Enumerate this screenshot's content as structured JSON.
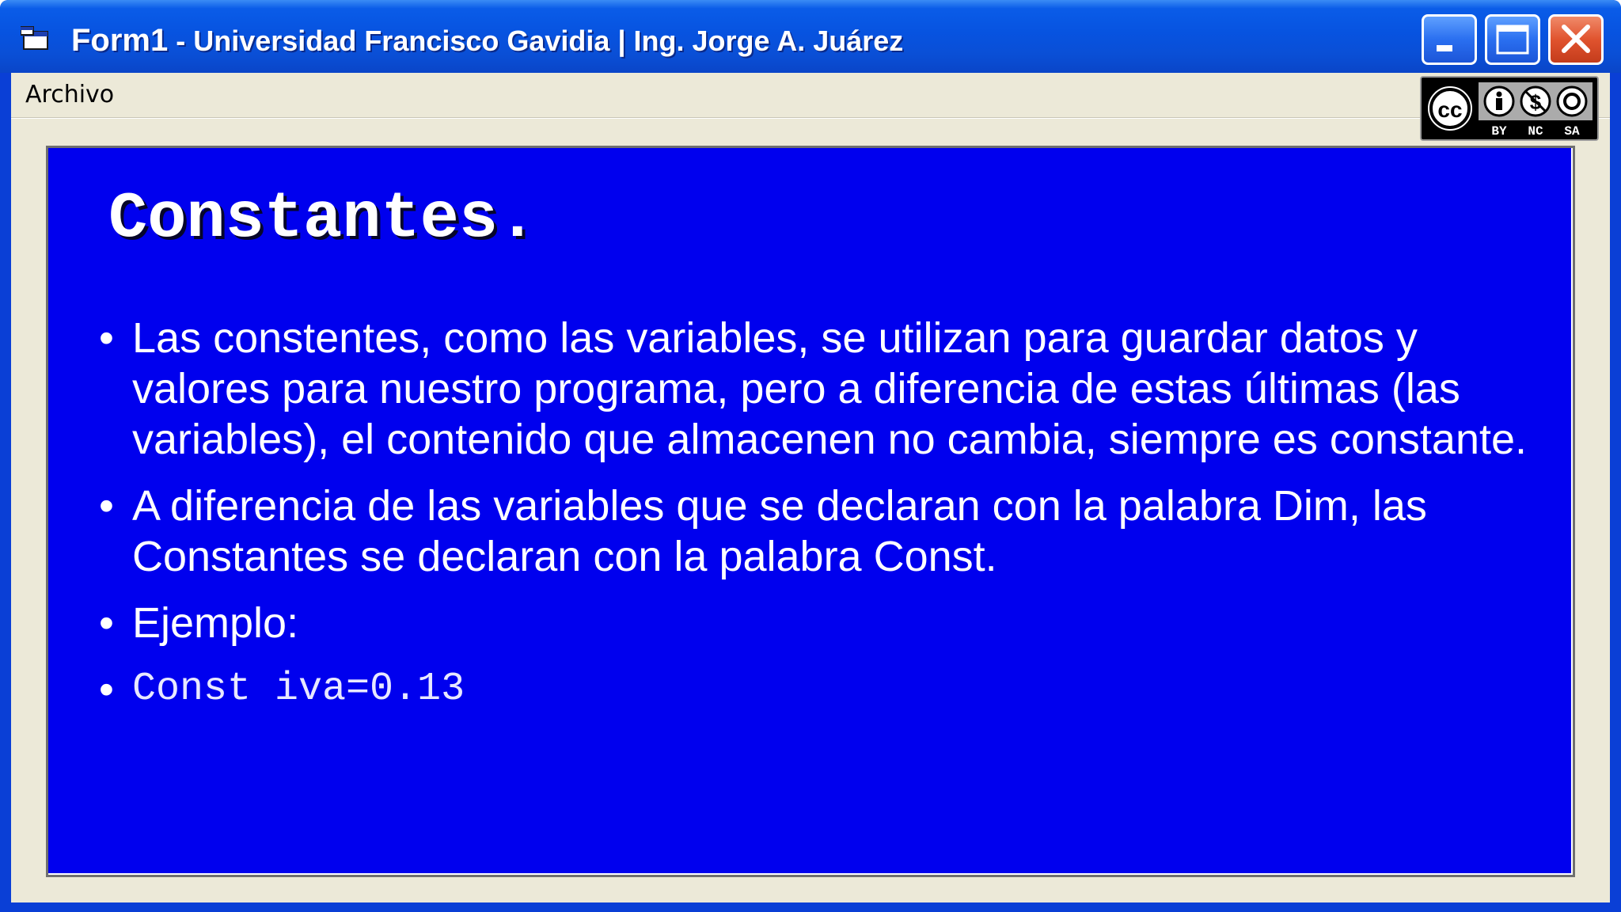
{
  "window": {
    "title_form": "Form1",
    "title_rest": " - Universidad Francisco Gavidia | Ing. Jorge A. Juárez",
    "minimize_icon": "minimize-icon",
    "maximize_icon": "maximize-icon",
    "close_icon": "close-icon",
    "app_icon": "form-window-icon"
  },
  "menu": {
    "items": [
      {
        "label": "Archivo"
      }
    ]
  },
  "license_badge": {
    "icon": "creative-commons-icon",
    "labels": [
      "BY",
      "NC",
      "SA"
    ]
  },
  "slide": {
    "title": "Constantes.",
    "bullets": [
      {
        "text": "Las constentes, como las variables, se utilizan para guardar datos y valores para nuestro programa, pero a diferencia de estas últimas (las variables), el contenido que almacenen no cambia, siempre es constante."
      },
      {
        "text": "A diferencia de las variables que se declaran con la palabra Dim, las Constantes se declaran con la palabra Const."
      },
      {
        "text": "Ejemplo:"
      },
      {
        "text": "Const iva=0.13"
      }
    ]
  },
  "colors": {
    "slide_background": "#0000ee",
    "titlebar": "#0a4fd6",
    "client": "#ece9d8",
    "text": "#ffffff"
  }
}
